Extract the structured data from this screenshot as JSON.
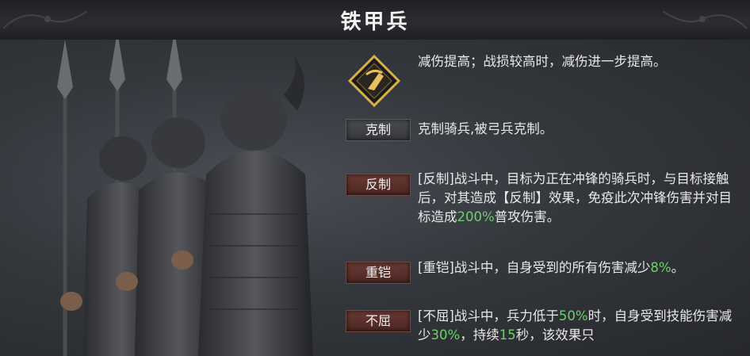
{
  "window": {
    "title": "铁甲兵"
  },
  "traits": [
    {
      "icon": "armor-shield-icon",
      "desc": "减伤提高；战损较高时，减伤进一步提高。"
    },
    {
      "tag": "克制",
      "desc": "克制骑兵,被弓兵克制。"
    },
    {
      "tag": "反制",
      "desc_parts": [
        "[反制]战斗中，目标为正在冲锋的骑兵时，与目标接触后，对其造成【反制】效果，免疫此次冲锋伤害并对目标造成",
        "200%",
        "普攻伤害。"
      ]
    },
    {
      "tag": "重铠",
      "desc_parts": [
        "[重铠]战斗中，自身受到的所有伤害减少",
        "8%",
        "。"
      ]
    },
    {
      "tag": "不屈",
      "desc_parts": [
        "[不屈]战斗中，兵力低于",
        "50%",
        "时，自身受到技能伤害减少",
        "30%",
        "，持续",
        "15",
        "秒，该效果只"
      ]
    }
  ],
  "colors": {
    "highlight": "#6cd16c",
    "tag_red": "#6a3a34",
    "tag_gray": "#4a4c50",
    "icon_gold": "#d9b14a"
  }
}
